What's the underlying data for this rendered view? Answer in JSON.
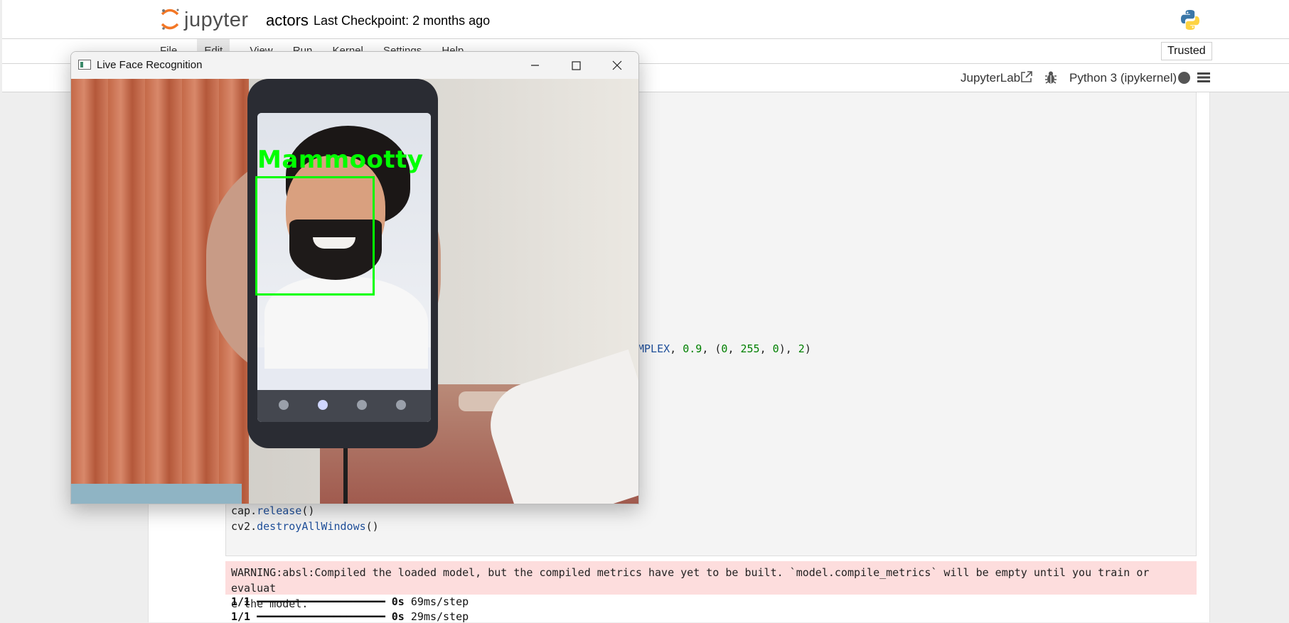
{
  "header": {
    "logo_text": "jupyter",
    "notebook_name": "actors",
    "checkpoint": "Last Checkpoint: 2 months ago"
  },
  "menu": {
    "items": [
      "File",
      "Edit",
      "View",
      "Run",
      "Kernel",
      "Settings",
      "Help"
    ],
    "trusted_label": "Trusted"
  },
  "toolbar": {
    "jupyterlab_label": "JupyterLab",
    "kernel_label": "Python 3 (ipykernel)"
  },
  "code": {
    "fragment_line": "MPLEX, 0.9, (0, 255, 0), 2)",
    "line_release": "cap.release()",
    "line_destroy": "cv2.destroyAllWindows()"
  },
  "output": {
    "warning_line1": "WARNING:absl:Compiled the loaded model, but the compiled metrics have yet to be built. `model.compile_metrics` will be empty until you train or evaluat",
    "warning_line2": "e the model.",
    "progress": [
      {
        "steps": "1/1",
        "bar": "━━━━━━━━━━━━━━━━━━━━",
        "time": "0s",
        "rate": "69ms/step"
      },
      {
        "steps": "1/1",
        "bar": "━━━━━━━━━━━━━━━━━━━━",
        "time": "0s",
        "rate": "29ms/step"
      }
    ]
  },
  "cv_window": {
    "title": "Live Face Recognition",
    "detection_label": "Mammootty",
    "box_color": "#00ff00"
  },
  "icons": {
    "python_logo": "python-logo-icon",
    "external_link": "external-link-icon",
    "debugger": "bug-icon",
    "kernel_status": "kernel-idle-icon",
    "menu": "hamburger-icon"
  }
}
